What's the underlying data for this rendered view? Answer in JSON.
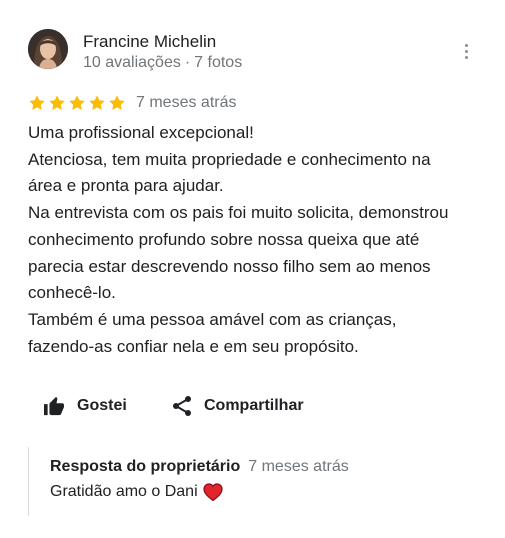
{
  "review": {
    "author": {
      "name": "Francine Michelin",
      "reviews_count": "10 avaliações",
      "photos_count": "7 fotos",
      "avatar_icon": "user-avatar-photo"
    },
    "rating": {
      "stars": 5,
      "max": 5,
      "color": "#fbbc04"
    },
    "date": "7 meses atrás",
    "text_lines": [
      "Uma profissional excepcional!",
      "Atenciosa, tem muita propriedade e conhecimento na",
      "área e pronta para ajudar.",
      "Na entrevista com os pais foi muito solicita, demonstrou",
      "conhecimento profundo sobre nossa queixa que até",
      "parecia estar descrevendo nosso filho sem ao menos",
      "conhecê-lo.",
      "Também é uma pessoa amável com as crianças,",
      "fazendo-as confiar nela e em seu propósito."
    ],
    "actions": {
      "like": {
        "label": "Gostei",
        "icon": "thumbs-up-icon"
      },
      "share": {
        "label": "Compartilhar",
        "icon": "share-icon"
      }
    },
    "more_icon": "more-vert-icon"
  },
  "owner_reply": {
    "title": "Resposta do proprietário",
    "date": "7 meses atrás",
    "text": "Gratidão amo o Dani",
    "emoji_icon": "red-heart-icon"
  },
  "colors": {
    "text_primary": "#202124",
    "text_secondary": "#70757a",
    "star": "#fbbc04",
    "heart": "#e0252d",
    "divider": "#dadce0"
  }
}
